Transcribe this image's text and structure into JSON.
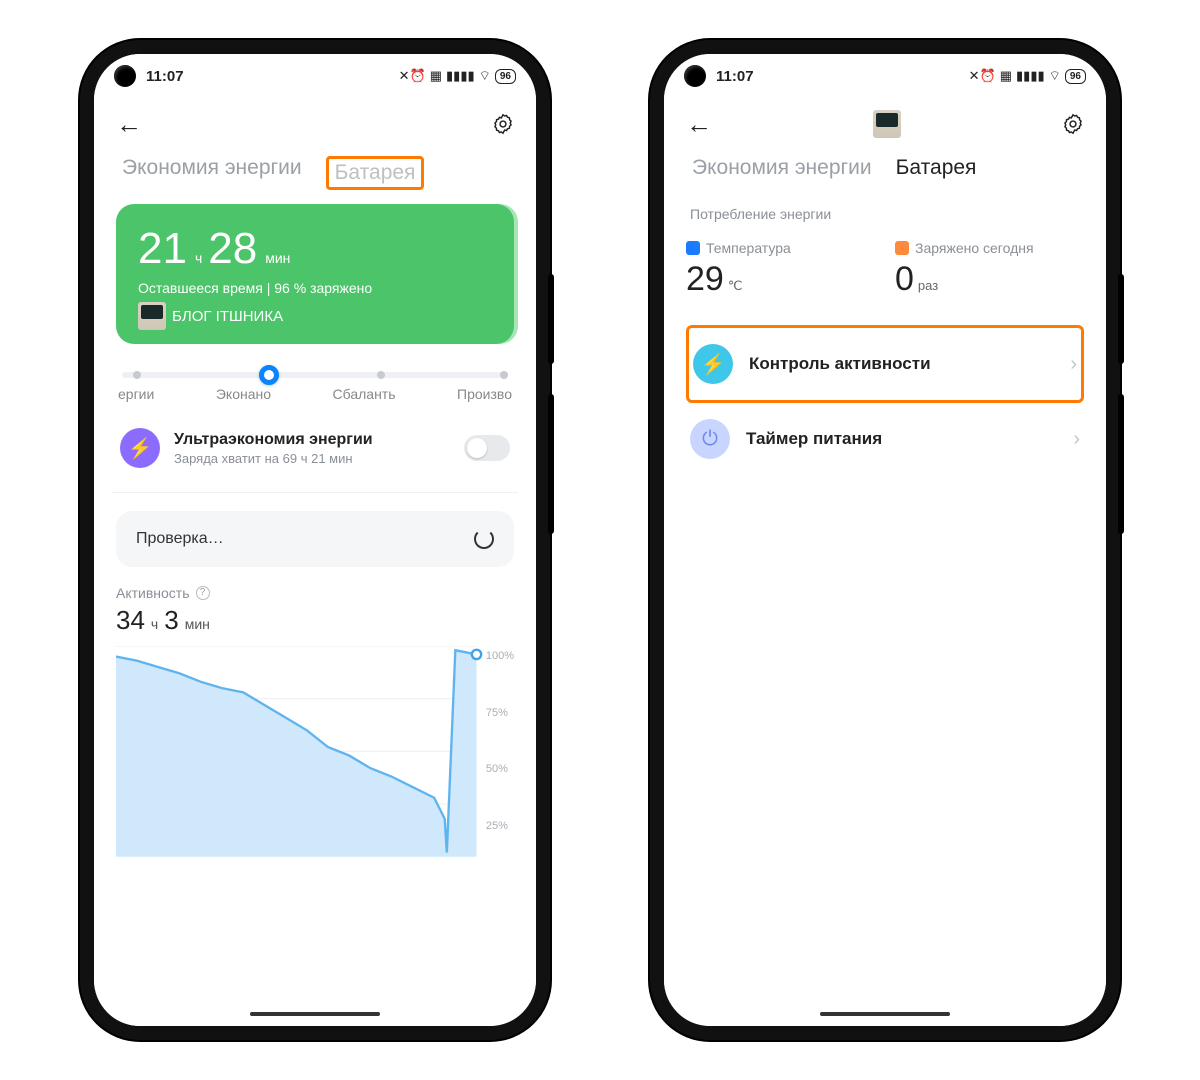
{
  "status": {
    "time": "11:07",
    "battery": "96"
  },
  "left": {
    "tabs": {
      "inactive": "Экономия энергии",
      "active": "Батарея"
    },
    "card": {
      "h": "21",
      "hUnit": "ч",
      "m": "28",
      "mUnit": "мин",
      "sub": "Оставшееся время | 96 % заряжено",
      "watermark": "БЛОГ ІТШНИКА"
    },
    "slider": {
      "o1": "ергии",
      "o2": "Эконано",
      "o3": "Сбаланть",
      "o4": "Произво"
    },
    "ultra": {
      "title": "Ультраэкономия энергии",
      "sub": "Заряда хватит на 69 ч 21 мин"
    },
    "check": "Проверка…",
    "activity": {
      "label": "Активность",
      "h": "34",
      "hUnit": "ч",
      "m": "3",
      "mUnit": "мин"
    },
    "chart_ylabels": [
      "100%",
      "75%",
      "50%",
      "25%"
    ]
  },
  "right": {
    "tabs": {
      "inactive": "Экономия энергии",
      "active": "Батарея"
    },
    "section": "Потребление энергии",
    "temp": {
      "label": "Температура",
      "value": "29",
      "unit": "℃"
    },
    "charged": {
      "label": "Заряжено сегодня",
      "value": "0",
      "unit": "раз"
    },
    "item1": "Контроль активности",
    "item2": "Таймер питания"
  },
  "chart_data": {
    "type": "area",
    "title": "Активность",
    "ylim": [
      0,
      100
    ],
    "ylabel": "%",
    "x": [
      0,
      2,
      4,
      6,
      8,
      10,
      12,
      14,
      16,
      18,
      20,
      22,
      24,
      26,
      28,
      30,
      31,
      31.2,
      32,
      34
    ],
    "values": [
      95,
      93,
      90,
      87,
      83,
      80,
      78,
      72,
      66,
      60,
      52,
      48,
      42,
      38,
      33,
      28,
      18,
      2,
      98,
      96
    ]
  }
}
